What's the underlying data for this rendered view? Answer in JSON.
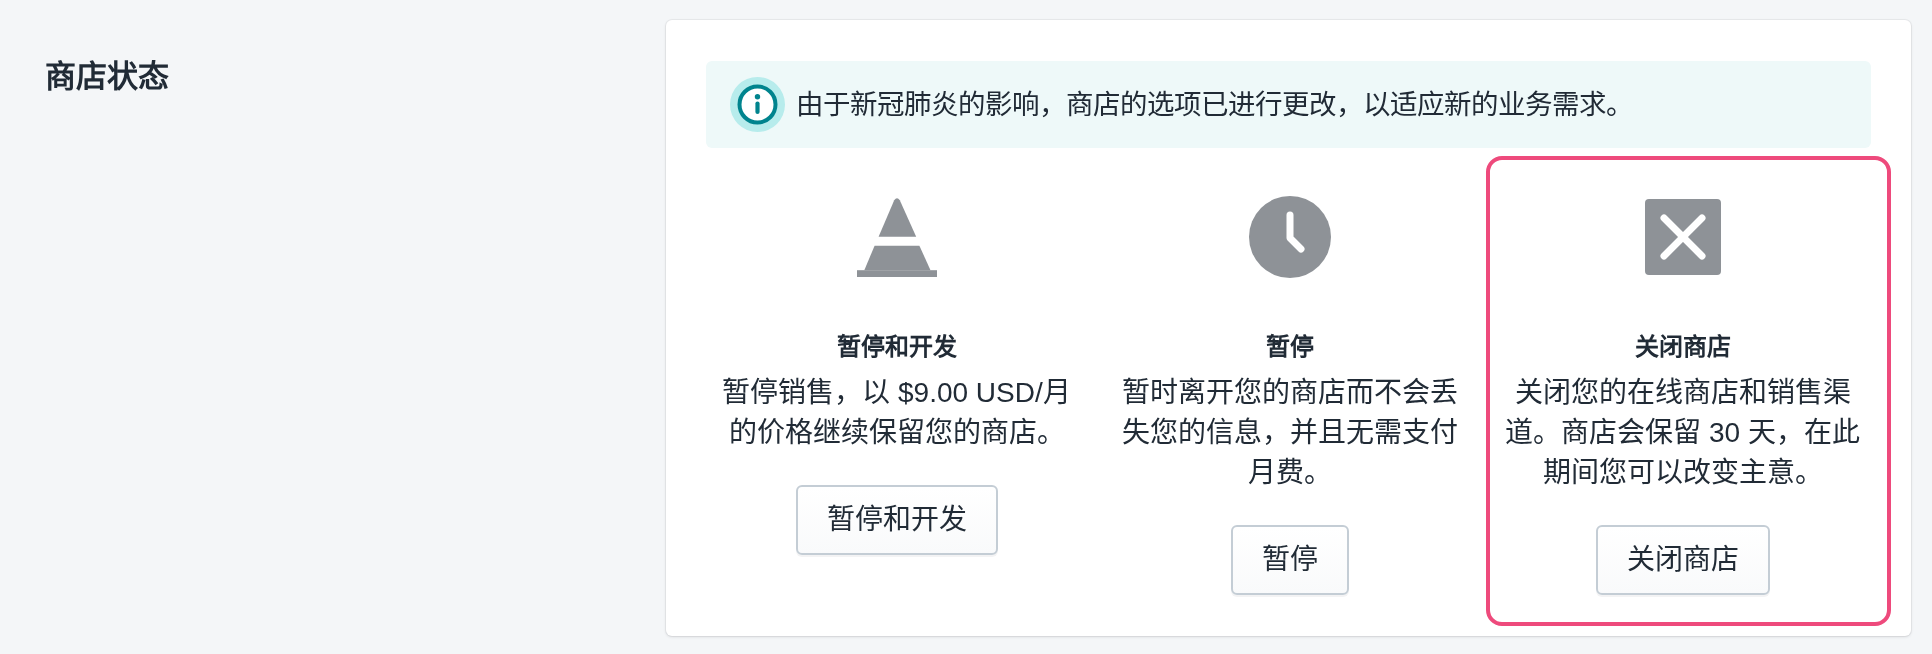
{
  "section": {
    "title": "商店状态"
  },
  "banner": {
    "text": "由于新冠肺炎的影响，商店的选项已进行更改，以适应新的业务需求。"
  },
  "options": [
    {
      "kind": "pause_and_build",
      "title": "暂停和开发",
      "description": "暂停销售，以 $9.00 USD/月的价格继续保留您的商店。",
      "button": "暂停和开发",
      "highlighted": false
    },
    {
      "kind": "pause",
      "title": "暂停",
      "description": "暂时离开您的商店而不会丢失您的信息，并且无需支付月费。",
      "button": "暂停",
      "highlighted": false
    },
    {
      "kind": "close",
      "title": "关闭商店",
      "description": "关闭您的在线商店和销售渠道。商店会保留 30 天，在此期间您可以改变主意。",
      "button": "关闭商店",
      "highlighted": true
    }
  ]
}
